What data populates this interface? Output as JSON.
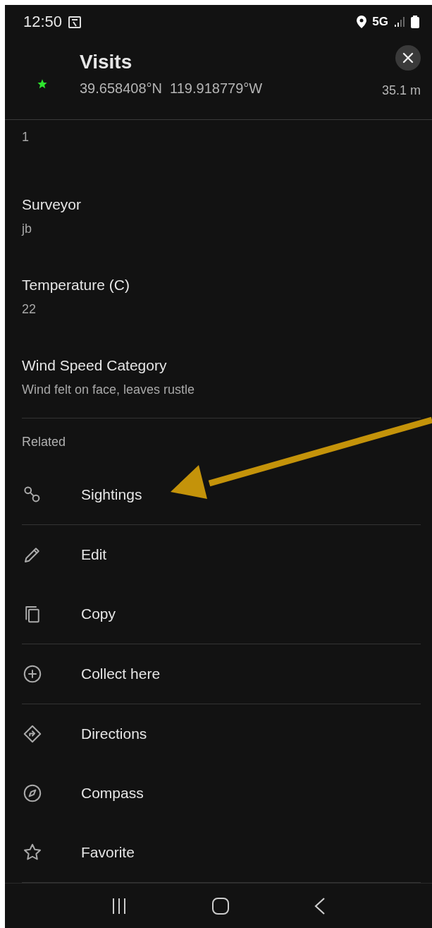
{
  "status_bar": {
    "time": "12:50",
    "network": "5G"
  },
  "header": {
    "title": "Visits",
    "coordinates": "39.658408°N  119.918779°W",
    "distance": "35.1 m"
  },
  "fields": [
    {
      "value": "1"
    },
    {
      "label": "Surveyor",
      "value": "jb"
    },
    {
      "label": "Temperature (C)",
      "value": "22"
    },
    {
      "label": "Wind Speed Category",
      "value": "Wind felt on face, leaves rustle"
    }
  ],
  "related": {
    "heading": "Related",
    "groups": [
      [
        {
          "label": "Sightings",
          "kind": "link"
        }
      ],
      [
        {
          "label": "Edit",
          "kind": "edit"
        },
        {
          "label": "Copy",
          "kind": "copy"
        }
      ],
      [
        {
          "label": "Collect here",
          "kind": "collect"
        }
      ],
      [
        {
          "label": "Directions",
          "kind": "directions"
        },
        {
          "label": "Compass",
          "kind": "compass"
        },
        {
          "label": "Favorite",
          "kind": "favorite"
        }
      ]
    ]
  }
}
